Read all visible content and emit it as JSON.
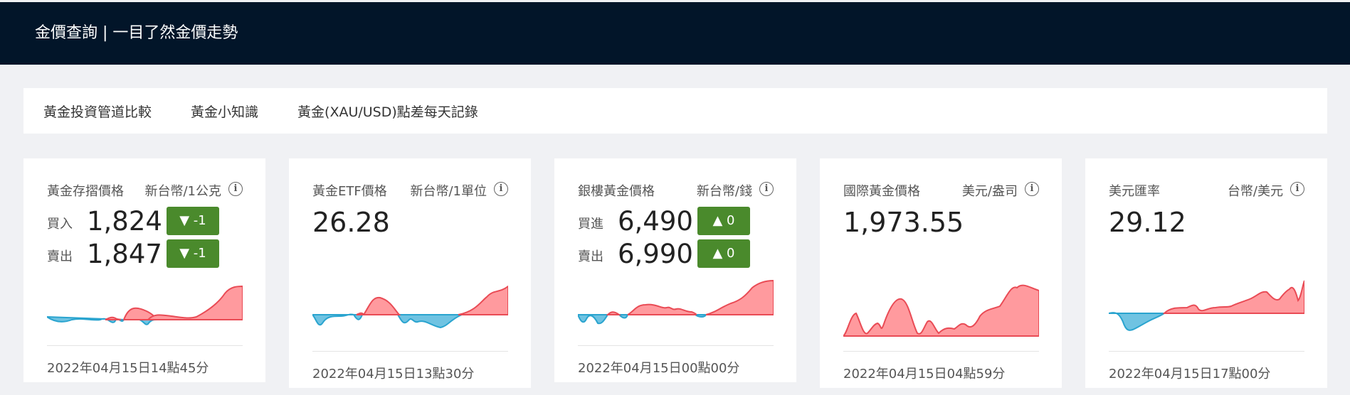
{
  "header": {
    "title": "金價查詢 | 一目了然金價走勢"
  },
  "nav": {
    "items": [
      {
        "label": "黃金投資管道比較"
      },
      {
        "label": "黃金小知識"
      },
      {
        "label": "黃金(XAU/USD)點差每天記錄"
      }
    ]
  },
  "cards": [
    {
      "label": "黃金存摺價格",
      "unit": "新台幣/1公克",
      "buy_label": "買入",
      "buy_value": "1,824",
      "buy_change": "▼ -1",
      "sell_label": "賣出",
      "sell_value": "1,847",
      "sell_change": "▼ -1",
      "timestamp": "2022年04月15日14點45分"
    },
    {
      "label": "黃金ETF價格",
      "unit": "新台幣/1單位",
      "value": "26.28",
      "timestamp": "2022年04月15日13點30分"
    },
    {
      "label": "銀樓黃金價格",
      "unit": "新台幣/錢",
      "buy_label": "買進",
      "buy_value": "6,490",
      "buy_change": "▲ 0",
      "sell_label": "賣出",
      "sell_value": "6,990",
      "sell_change": "▲ 0",
      "timestamp": "2022年04月15日00點00分"
    },
    {
      "label": "國際黃金價格",
      "unit": "美元/盎司",
      "value": "1,973.55",
      "timestamp": "2022年04月15日04點59分"
    },
    {
      "label": "美元匯率",
      "unit": "台幣/美元",
      "value": "29.12",
      "timestamp": "2022年04月15日17點00分"
    }
  ],
  "colors": {
    "header_bg": "#021529",
    "badge_bg": "#4a8a2c",
    "up_fill": "#ff9a9e",
    "up_stroke": "#e94b55",
    "down_fill": "#6fc3e2",
    "down_stroke": "#2aa4cf"
  }
}
